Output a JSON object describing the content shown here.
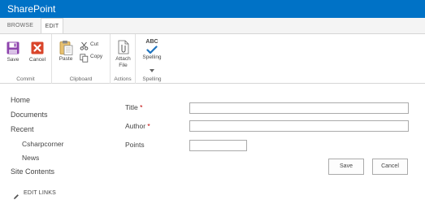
{
  "app": {
    "suite_title": "SharePoint"
  },
  "colors": {
    "brand": "#0072c6",
    "required": "#bf0000"
  },
  "ribbon": {
    "tabs": [
      {
        "label": "BROWSE",
        "selected": false
      },
      {
        "label": "EDIT",
        "selected": true
      }
    ],
    "commit": {
      "label": "Commit",
      "save": {
        "label": "Save",
        "icon": "save-icon"
      },
      "cancel": {
        "label": "Cancel",
        "icon": "cancel-icon"
      }
    },
    "clipboard": {
      "label": "Clipboard",
      "paste": {
        "label": "Paste",
        "icon": "paste-icon"
      },
      "cut": {
        "label": "Cut",
        "icon": "cut-icon"
      },
      "copy": {
        "label": "Copy",
        "icon": "copy-icon"
      }
    },
    "actions": {
      "label": "Actions",
      "attach_file": {
        "label_line1": "Attach",
        "label_line2": "File",
        "icon": "attach-file-icon"
      }
    },
    "spelling": {
      "label": "Spelling",
      "spelling_button": {
        "label": "Spelling",
        "icon_text": "ABC",
        "icon": "spellcheck-icon"
      }
    }
  },
  "nav": {
    "items": [
      {
        "label": "Home"
      },
      {
        "label": "Documents"
      },
      {
        "label": "Recent"
      },
      {
        "label": "Csharpcorner"
      },
      {
        "label": "News"
      },
      {
        "label": "Site Contents"
      }
    ],
    "edit_links": {
      "label": "EDIT LINKS",
      "icon": "pencil-icon"
    }
  },
  "form": {
    "fields": [
      {
        "label": "Title",
        "required_marker": "*",
        "value": ""
      },
      {
        "label": "Author",
        "required_marker": "*",
        "value": ""
      },
      {
        "label": "Points",
        "value": ""
      }
    ],
    "save_label": "Save",
    "cancel_label": "Cancel"
  }
}
